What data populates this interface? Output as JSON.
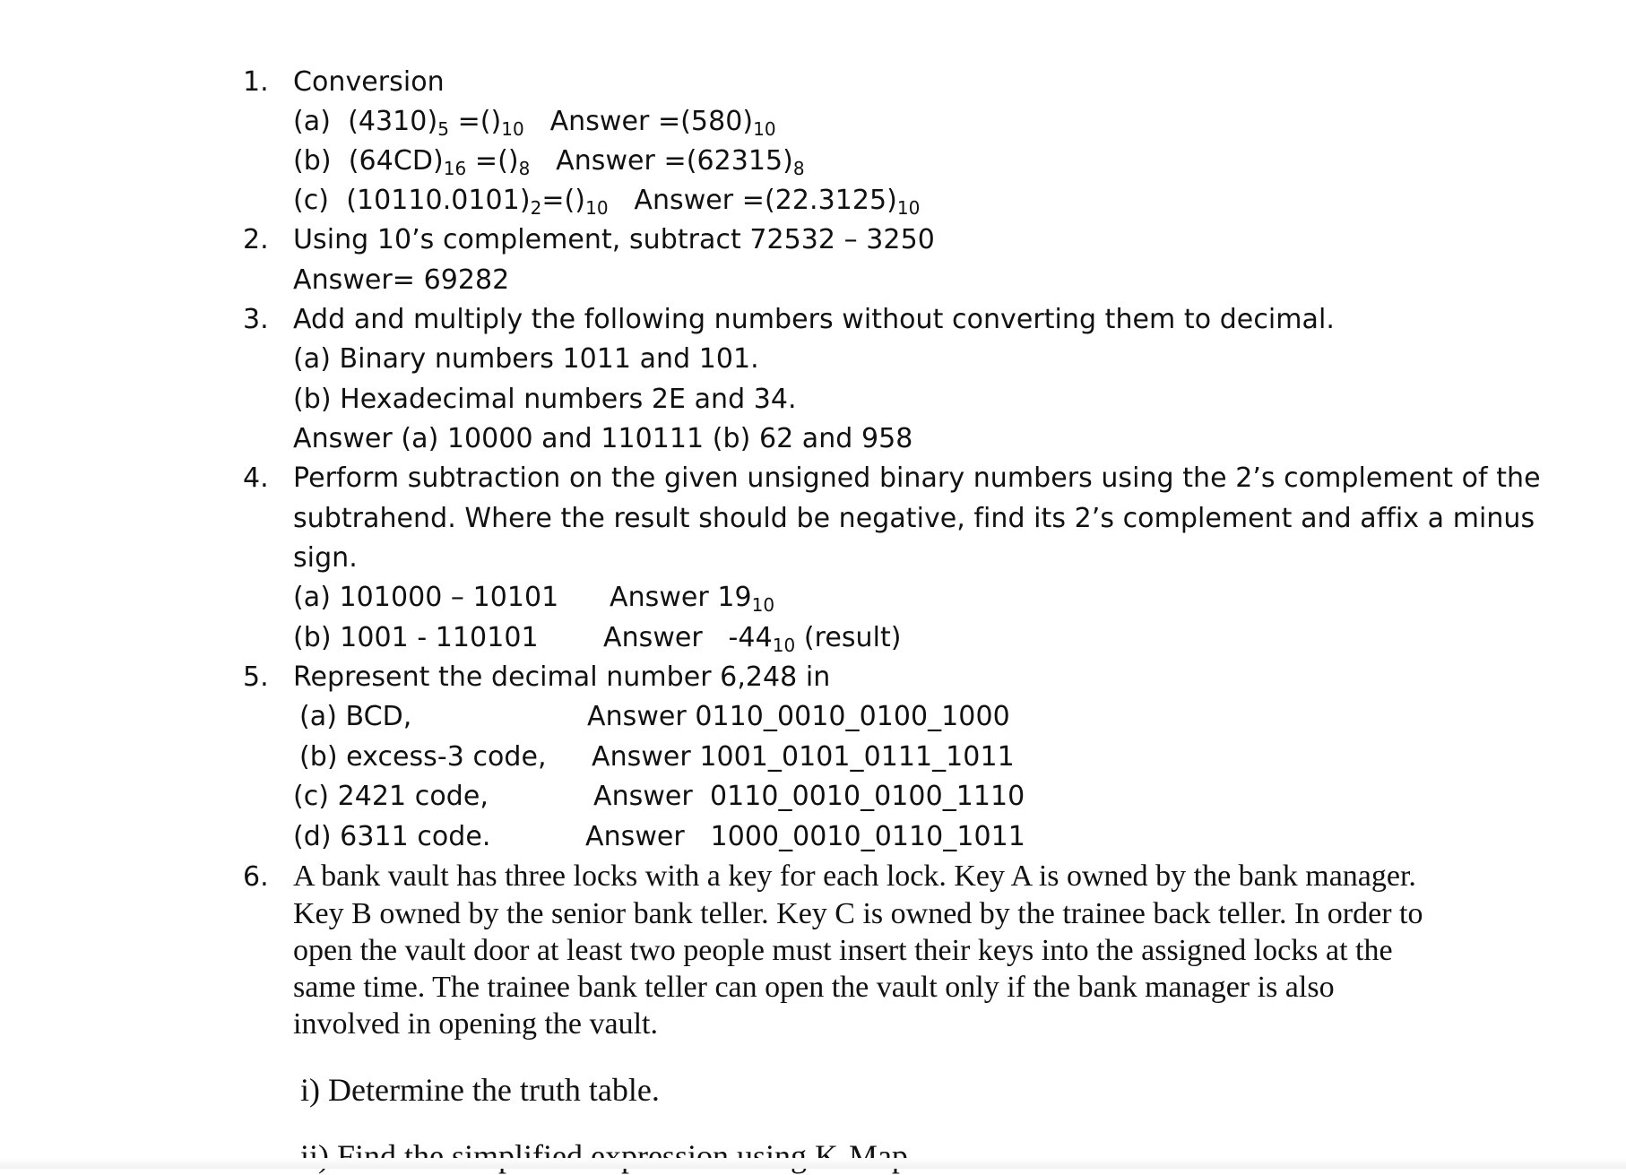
{
  "q1": {
    "number": "1.",
    "title": "Conversion",
    "a": {
      "label": "(a)",
      "expr": "(4310)",
      "base": "5",
      "eq": "=()",
      "target_base": "10",
      "ans_pre": "Answer =(580)",
      "ans_base": "10"
    },
    "b": {
      "label": "(b)",
      "expr": "(64CD)",
      "base": "16",
      "eq": "=()",
      "target_base": "8",
      "ans_pre": "Answer =(62315)",
      "ans_base": "8"
    },
    "c": {
      "label": "(c)",
      "expr": "(10110.0101)",
      "base": "2",
      "eq": "=()",
      "target_base": "10",
      "ans_pre": "Answer =(22.3125)",
      "ans_base": "10"
    }
  },
  "q2": {
    "number": "2.",
    "text": "Using 10’s complement, subtract 72532 – 3250",
    "answer": "Answer= 69282"
  },
  "q3": {
    "number": "3.",
    "text": "Add and multiply the following numbers without converting them to decimal.",
    "a": "(a) Binary numbers 1011 and 101.",
    "b": "(b) Hexadecimal numbers 2E and 34.",
    "answer": "Answer (a) 10000 and 110111 (b) 62 and 958"
  },
  "q4": {
    "number": "4.",
    "line1": "Perform subtraction on the given unsigned binary numbers using the 2’s complement of the",
    "line2": "subtrahend. Where the result should be negative, find its 2’s complement and affix a minus",
    "line3": "sign.",
    "a": {
      "expr": "(a) 101000 – 10101",
      "ans_pre": "Answer 19",
      "ans_base": "10"
    },
    "b": {
      "expr": "(b)  1001 - 110101",
      "ans_pre": "Answer   -44",
      "ans_base": "10",
      "ans_post": " (result)"
    }
  },
  "q5": {
    "number": "5.",
    "text": "Represent the decimal number 6,248 in",
    "a": {
      "label": "(a) BCD,",
      "answer": "Answer 0110_0010_0100_1000"
    },
    "b": {
      "label": "(b) excess-3 code,",
      "answer": "Answer 1001_0101_0111_1011"
    },
    "c": {
      "label": "(c) 2421 code,",
      "answer": "Answer  0110_0010_0100_1110"
    },
    "d": {
      "label": "(d) 6311 code.",
      "answer": "Answer   1000_0010_0110_1011"
    }
  },
  "q6": {
    "number": "6.",
    "lines": [
      "A bank vault has three locks with a key for each lock. Key A is owned by the bank manager.",
      "Key B owned by the senior bank teller. Key C is owned by the trainee back teller. In order to",
      "open the vault door at least two people must insert their keys into the assigned locks at the",
      "same time. The trainee bank teller can open the vault only if the bank manager is also",
      "involved in opening the vault."
    ],
    "i": "i) Determine the truth table.",
    "ii": "ii) Find the simplified expression using K-Map."
  }
}
